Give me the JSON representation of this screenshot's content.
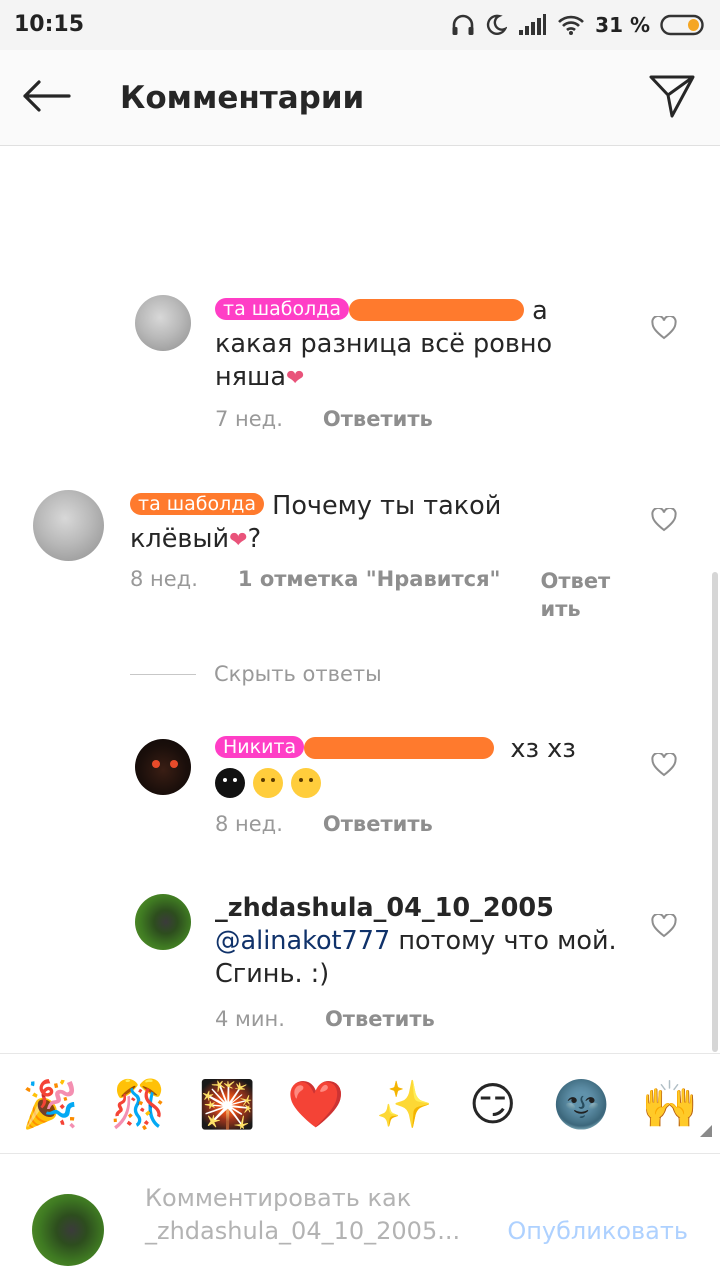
{
  "status_bar": {
    "time": "10:15",
    "battery_percent": "31 %",
    "battery_level": 0.31,
    "icons": [
      "headphones-icon",
      "moon-icon",
      "signal-icon",
      "wifi-icon",
      "battery-icon"
    ]
  },
  "header": {
    "title": "Комментарии",
    "back_icon": "arrow-left-icon",
    "send_icon": "paper-plane-icon"
  },
  "comments": [
    {
      "user_redacted_label": "та шаболда",
      "text": " а какая разница всё ровно няша",
      "emoji": "❤",
      "time": "7 нед.",
      "reply_label": "Ответить",
      "liked": false
    },
    {
      "user_redacted_label": "та шаболда",
      "text": "Почему ты такой клёвый",
      "emoji": "❤",
      "suffix": "?",
      "time": "8 нед.",
      "likes_label": "1 отметка \"Нравится\"",
      "reply_label": "Ответ ить",
      "liked": false
    }
  ],
  "replies_toggle": {
    "label": "Скрыть ответы"
  },
  "replies": [
    {
      "user_redacted_label": "Никита",
      "text": "хз хз",
      "time": "8 нед.",
      "reply_label": "Ответить",
      "liked": false
    },
    {
      "username": "_zhdashula_04_10_2005",
      "mention": "@alinakot777",
      "text": "  потому что мой. Сгинь. :)",
      "time": "4 мин.",
      "reply_label": "Ответить",
      "liked": false
    }
  ],
  "emoji_bar": {
    "items": [
      "🎉",
      "🎊",
      "🎇",
      "❤️",
      "✨",
      "😏",
      "🌚",
      "🙌"
    ]
  },
  "composer": {
    "placeholder": "Комментировать как\n_zhdashula_04_10_2005...",
    "publish_label": "Опубликовать"
  },
  "colors": {
    "accent": "#3897f0",
    "publish_disabled": "#aed1ff",
    "redact_pink": "#ff3ec6",
    "redact_orange": "#ff7a2d",
    "heart": "#e9537a"
  }
}
